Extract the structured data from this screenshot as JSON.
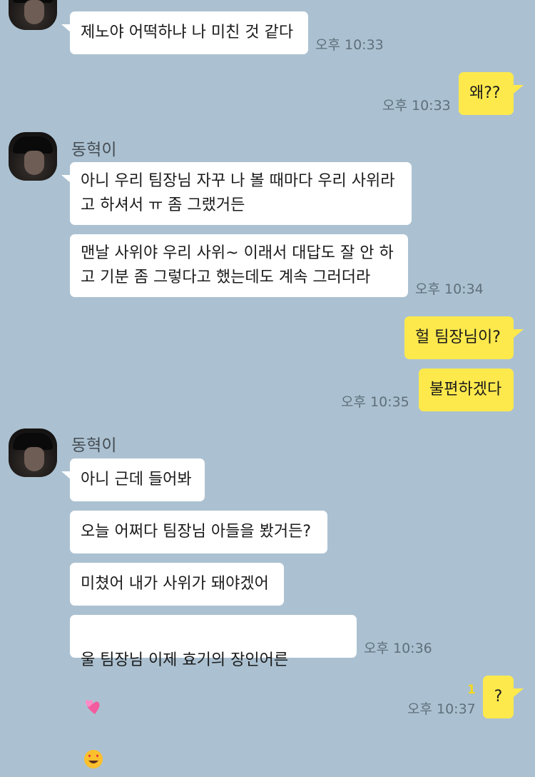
{
  "messages": {
    "m1": {
      "text": "제노야 어떡하냐 나 미친 것 같다",
      "time": "오후 10:33"
    },
    "m2": {
      "text": "왜??",
      "time": "오후 10:33"
    },
    "sender1": {
      "name": "동혁이"
    },
    "m3": {
      "text": "아니 우리 팀장님 자꾸 나 볼 때마다 우리 사위라\n고 하셔서 ㅠ 좀 그랬거든"
    },
    "m4": {
      "text": "맨날 사위야 우리 사위~ 이래서 대답도 잘 안 하\n고 기분 좀 그렇다고 했는데도 계속 그러더라",
      "time": "오후 10:34"
    },
    "m5": {
      "text": "헐 팀장님이?"
    },
    "m6": {
      "text": "불편하겠다",
      "time": "오후 10:35"
    },
    "sender2": {
      "name": "동혁이"
    },
    "m7": {
      "text": "아니 근데 들어봐"
    },
    "m8": {
      "text": "오늘 어쩌다 팀장님 아들을 봤거든?"
    },
    "m9": {
      "text": "미쳤어 내가 사위가 돼야겠어"
    },
    "m10": {
      "text": "울 팀장님 이제 효기의 장인어른",
      "emojis": [
        "two-hearts",
        "heart-eyes"
      ],
      "time": "오후 10:36"
    },
    "m11": {
      "text": "?",
      "unread": "1",
      "time": "오후 10:37"
    }
  },
  "colors": {
    "background": "#abc1d1",
    "my_bubble": "#fee94d",
    "their_bubble": "#ffffff",
    "unread": "#f5d81a"
  }
}
